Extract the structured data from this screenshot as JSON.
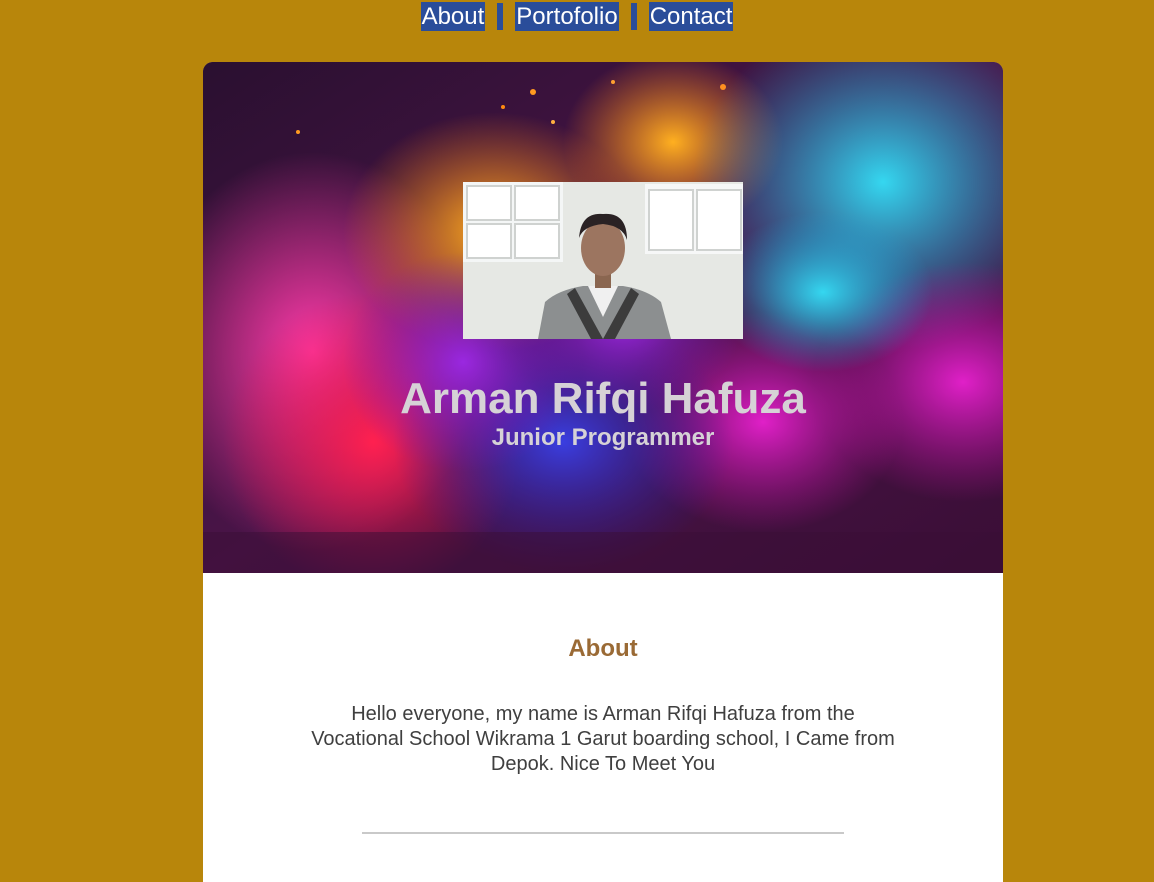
{
  "nav": {
    "items": [
      {
        "label": "About"
      },
      {
        "label": "Portofolio"
      },
      {
        "label": "Contact"
      }
    ]
  },
  "hero": {
    "name": "Arman Rifqi Hafuza",
    "role": "Junior Programmer"
  },
  "about": {
    "title": "About",
    "text": "Hello everyone, my name is Arman Rifqi Hafuza from the Vocational School Wikrama 1 Garut boarding school, I Came from Depok. Nice To Meet You"
  },
  "colors": {
    "page_background": "#b8860b",
    "nav_background": "#2a4d9a",
    "about_title": "#9a6a35",
    "card": "#ffffff"
  }
}
